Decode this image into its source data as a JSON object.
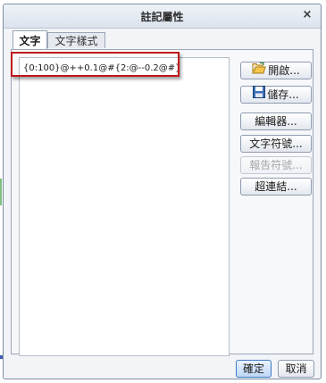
{
  "dialog": {
    "title": "註記屬性",
    "close_symbol": "×"
  },
  "tabs": [
    {
      "label": "文字",
      "active": true
    },
    {
      "label": "文字樣式",
      "active": false
    }
  ],
  "editor": {
    "value": "{0:100}@++0.1@#{2:@--0.2@#}"
  },
  "buttons": {
    "open": "開啟...",
    "save": "儲存...",
    "editor": "編輯器...",
    "text_symbol": "文字符號...",
    "report_symbol": "報告符號...",
    "hyperlink": "超連結..."
  },
  "footer": {
    "ok": "確定",
    "cancel": "取消"
  },
  "icons": {
    "open": "open-folder-icon",
    "save": "floppy-disk-icon"
  },
  "colors": {
    "highlight": "#c0151c",
    "primary_border": "#3f79c6"
  }
}
